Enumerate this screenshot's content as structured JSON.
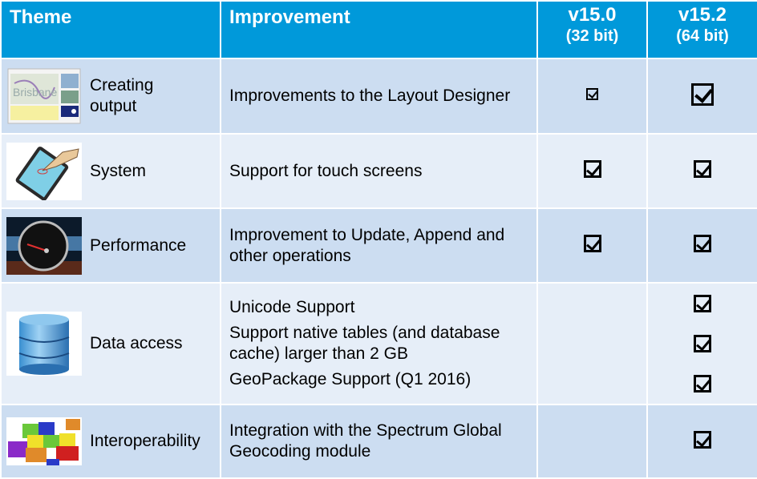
{
  "header": {
    "theme": "Theme",
    "improvement": "Improvement",
    "v150": {
      "version": "v15.0",
      "bits": "(32 bit)"
    },
    "v152": {
      "version": "v15.2",
      "bits": "(64 bit)"
    }
  },
  "colors": {
    "header_bg": "#0099DA",
    "row_dark": "#CCDDF1",
    "row_light": "#E6EEF8"
  },
  "rows": [
    {
      "theme": "Creating output",
      "icon": "layout-map-thumbnail-icon",
      "improvements": [
        "Improvements to the Layout Designer"
      ],
      "v150": [
        true
      ],
      "v152": [
        true
      ]
    },
    {
      "theme": "System",
      "icon": "touch-tablet-icon",
      "improvements": [
        "Support for touch screens"
      ],
      "v150": [
        true
      ],
      "v152": [
        true
      ]
    },
    {
      "theme": "Performance",
      "icon": "speedometer-icon",
      "improvements": [
        "Improvement to Update, Append and other operations"
      ],
      "v150": [
        true
      ],
      "v152": [
        true
      ]
    },
    {
      "theme": "Data access",
      "icon": "database-icon",
      "improvements": [
        "Unicode Support",
        "Support native tables (and database cache) larger than 2 GB",
        "GeoPackage Support (Q1 2016)"
      ],
      "v150": [
        false,
        false,
        false
      ],
      "v152": [
        true,
        true,
        true
      ]
    },
    {
      "theme": "Interoperability",
      "icon": "puzzle-pieces-icon",
      "improvements": [
        "Integration with the Spectrum Global Geocoding module"
      ],
      "v150": [
        false
      ],
      "v152": [
        true
      ]
    }
  ]
}
